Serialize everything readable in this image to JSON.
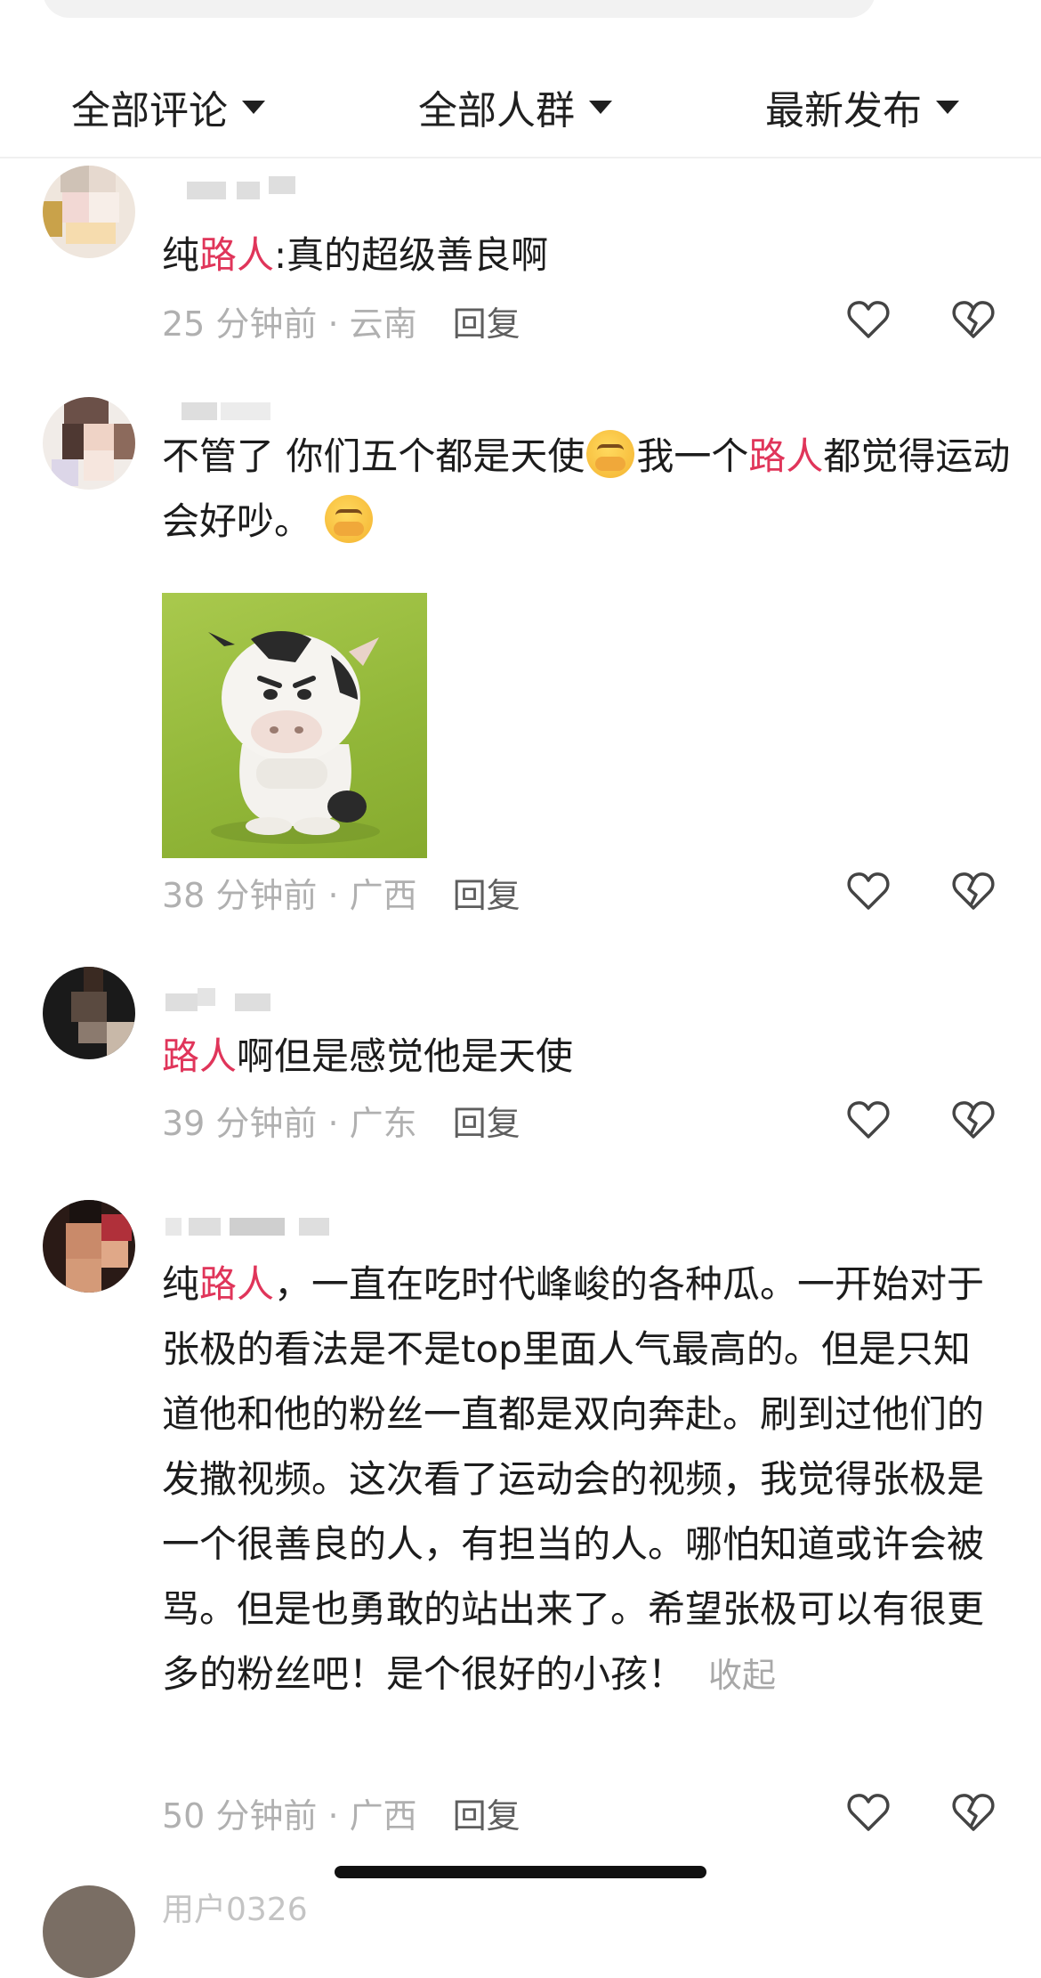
{
  "filters": [
    {
      "label": "全部评论"
    },
    {
      "label": "全部人群"
    },
    {
      "label": "最新发布"
    }
  ],
  "colors": {
    "highlight": "#e0355a",
    "meta_time": "#b0b0b0",
    "reply": "#5e5e5e"
  },
  "comments": [
    {
      "segments": [
        "纯",
        "路人",
        ":真的超级善良啊"
      ],
      "time_location": "25 分钟前 · 云南",
      "reply_label": "回复"
    },
    {
      "segments": [
        "不管了 你们五个都是天使",
        "我一个",
        "路人",
        "都觉得运动会好吵。"
      ],
      "emoji": "crying-emoji",
      "has_sticker": true,
      "time_location": "38 分钟前 · 广西",
      "reply_label": "回复"
    },
    {
      "segments": [
        "路人",
        "啊但是感觉他是天使"
      ],
      "time_location": "39 分钟前 · 广东",
      "reply_label": "回复"
    },
    {
      "segments": [
        "纯",
        "路人",
        "，一直在吃时代峰峻的各种瓜。一开始对于张极的看法是不是top里面人气最高的。但是只知道他和他的粉丝一直都是双向奔赴。刷到过他们的发撒视频。这次看了运动会的视频，我觉得张极是一个很善良的人，有担当的人。哪怕知道或许会被骂。但是也勇敢的站出来了。希望张极可以有很更多的粉丝吧！是个很好的小孩！"
      ],
      "collapse_label": "收起",
      "time_location": "50 分钟前 · 广西",
      "reply_label": "回复"
    }
  ],
  "next_comment": {
    "username": "用户0326"
  }
}
